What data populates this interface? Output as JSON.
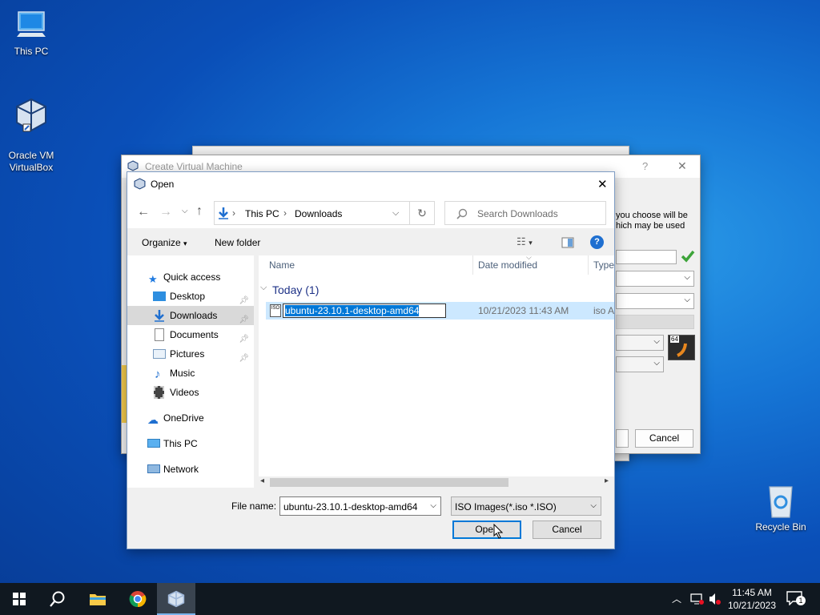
{
  "desktop": {
    "icons": [
      {
        "label": "This PC"
      },
      {
        "label": "Oracle VM\nVirtualBox"
      },
      {
        "label": "Recycle Bin"
      }
    ]
  },
  "vbox_dialog": {
    "title": "Create Virtual Machine",
    "help": "?",
    "close": "✕",
    "text_line1": "you choose will be",
    "text_line2": "hich may be used",
    "cancel": "Cancel",
    "os_badge": "64"
  },
  "open_dialog": {
    "title": "Open",
    "close": "✕",
    "breadcrumb": [
      "This PC",
      "Downloads"
    ],
    "search_placeholder": "Search Downloads",
    "organize": "Organize",
    "new_folder": "New folder",
    "help": "?",
    "nav": {
      "quick_access": "Quick access",
      "items": [
        {
          "label": "Desktop"
        },
        {
          "label": "Downloads"
        },
        {
          "label": "Documents"
        },
        {
          "label": "Pictures"
        },
        {
          "label": "Music"
        },
        {
          "label": "Videos"
        }
      ],
      "onedrive": "OneDrive",
      "this_pc": "This PC",
      "network": "Network"
    },
    "columns": {
      "name": "Name",
      "date": "Date modified",
      "type": "Type"
    },
    "group": {
      "label": "Today (1)"
    },
    "files": [
      {
        "name": "ubuntu-23.10.1-desktop-amd64",
        "date": "10/21/2023 11:43 AM",
        "type": "iso A",
        "icon_label": "ISO"
      }
    ],
    "file_name_label": "File name:",
    "file_name_value": "ubuntu-23.10.1-desktop-amd64",
    "file_type": "ISO Images(*.iso *.ISO)",
    "open_btn": "Open",
    "cancel_btn": "Cancel"
  },
  "taskbar": {
    "time": "11:45 AM",
    "date": "10/21/2023",
    "notifications": "1"
  },
  "colors": {
    "accent": "#0078d7",
    "selection": "#cce8ff",
    "taskbar": "#101820"
  }
}
